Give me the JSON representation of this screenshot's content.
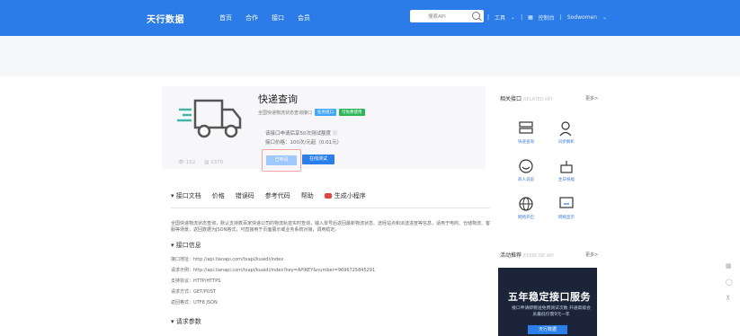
{
  "brand": {
    "logo": "天行数据"
  },
  "nav": {
    "links": [
      "首页",
      "合作",
      "接口",
      "会员"
    ]
  },
  "search": {
    "placeholder": "搜索API"
  },
  "rightnav": {
    "tools": "工具",
    "console": "控制台",
    "user": "Sodwomen"
  },
  "api": {
    "title": "快递查询",
    "subtitle": "全国快递物流状态查询接口",
    "tag1": "任务接口",
    "tag2": "可免费使用",
    "quota_line1": "该接口申请后享50次测试额度",
    "quota_line2": "接口价格：100次/元起（0.01元）",
    "apply_label": "已申请",
    "test_label": "在线测试",
    "views": "152",
    "count": "1370"
  },
  "tabs": [
    "接口文档",
    "价格",
    "错误码",
    "参考代码",
    "帮助",
    "生成小程序"
  ],
  "description": "全国快递物流状态查询，默认支持数百家快递公司的物流轨迹实时查询，输入单号后返回最新物流状态、途经站点和派送进度等信息，适用于电商、仓储物流、客服等场景，返回数据为JSON格式，可直接用于页面展示或业务系统对接，调用稳定。",
  "sections": {
    "basic_head": "接口信息",
    "params_head": "请求参数"
  },
  "basic_info": [
    "接口地址：http://api.tianapi.com/txapi/kuaidi/index",
    "请求示例：http://api.tianapi.com/txapi/kuaidi/index?key=APIKEY&number=9696725845291",
    "支持协议：HTTP/HTTPS",
    "请求方式：GET/POST",
    "返回格式：UTF8 JSON"
  ],
  "related": {
    "title": "相关接口",
    "title_en": "RELATED API",
    "more": "更多>",
    "items": [
      {
        "label": "快递查询",
        "icon": "server-icon"
      },
      {
        "label": "同步解析",
        "icon": "search-person-icon"
      },
      {
        "label": "商人说说",
        "icon": "smile-icon"
      },
      {
        "label": "生日祝福",
        "icon": "cake-icon"
      },
      {
        "label": "网络开启",
        "icon": "globe-icon"
      },
      {
        "label": "网络显示",
        "icon": "monitor-icon"
      }
    ]
  },
  "activity": {
    "title": "活动推荐",
    "title_en": "EXERCISE API",
    "more": "更多>",
    "promo_title": "五年稳定接口服务",
    "promo_sub": "接口申请即赠送免费测试次数 开通高级会员最低仅需9元一年",
    "promo_btn": "天行数据"
  },
  "colors": {
    "primary": "#2b7be8",
    "promo_bg": "#1b2438"
  }
}
